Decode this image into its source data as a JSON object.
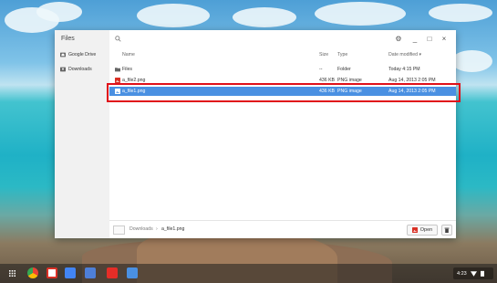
{
  "window": {
    "app_title": "Files",
    "search": {
      "placeholder": ""
    },
    "controls": {
      "settings": "⚙",
      "minimize": "_",
      "maximize": "□",
      "close": "×"
    }
  },
  "sidebar": {
    "items": [
      {
        "label": "Google Drive",
        "icon": "drive-icon"
      },
      {
        "label": "Downloads",
        "icon": "downloads-icon"
      }
    ]
  },
  "columns": {
    "name": "Name",
    "size": "Size",
    "type": "Type",
    "date": "Date modified ▾"
  },
  "files": [
    {
      "name": "Files",
      "size": "--",
      "type": "Folder",
      "date": "Today 4:15 PM",
      "icon": "folder-icon",
      "selected": false
    },
    {
      "name": "a_file2.png",
      "size": "436 KB",
      "type": "PNG image",
      "date": "Aug 14, 2013 2:05 PM",
      "icon": "image-icon",
      "selected": false
    },
    {
      "name": "a_file1.png",
      "size": "436 KB",
      "type": "PNG image",
      "date": "Aug 14, 2013 2:05 PM",
      "icon": "image-icon",
      "selected": true
    }
  ],
  "bottom": {
    "breadcrumb": [
      "Downloads",
      "a_file1.png"
    ],
    "separator": "›",
    "open_label": "Open"
  },
  "shelf": {
    "clock": "4:23"
  },
  "colors": {
    "selection": "#4a90e2",
    "highlight": "#e0101a",
    "image_icon": "#d93025"
  }
}
